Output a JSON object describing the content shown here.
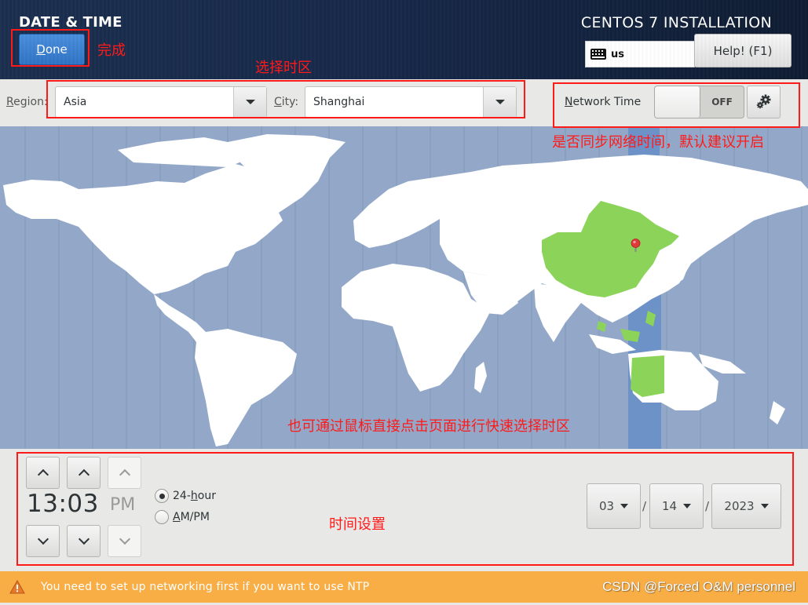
{
  "header": {
    "spoke_title": "DATE & TIME",
    "done_label_mnemonic": "D",
    "done_label_rest": "one",
    "product_title": "CENTOS 7 INSTALLATION",
    "keyboard_layout": "us",
    "help_label": "Help! (F1)"
  },
  "toolbar": {
    "region_label_mnemonic": "R",
    "region_label_rest": "egion:",
    "region_value": "Asia",
    "city_label_mnemonic": "C",
    "city_label_rest": "ity:",
    "city_value": "Shanghai",
    "network_time_label_mnemonic": "N",
    "network_time_label_rest": "etwork Time",
    "network_time_state": "OFF",
    "network_time_enabled": false
  },
  "map": {
    "selected_timezone": "Asia/Shanghai",
    "highlight_color": "#8cd35a",
    "ocean_color": "#93a8c8",
    "selected_zone_band_color": "#6d92c8",
    "pin_color": "#e03b3b"
  },
  "time": {
    "hours": "13",
    "separator": ":",
    "minutes": "03",
    "ampm": "PM",
    "format_24h_pre": "24-",
    "format_24h_mnemonic": "h",
    "format_24h_post": "our",
    "format_ampm_mnemonic": "A",
    "format_ampm_rest": "M/PM",
    "selected_format": "24-hour"
  },
  "date": {
    "month": "03",
    "day": "14",
    "year": "2023",
    "separator": "/"
  },
  "warning": {
    "message": "You need to set up networking first if you want to use NTP"
  },
  "watermark": "CSDN @Forced O&M personnel",
  "annotations": {
    "done": "完成",
    "select_timezone": "选择时区",
    "network_time": "是否同步网络时间，默认建议开启",
    "map_click": "也可通过鼠标直接点击页面进行快速选择时区",
    "time_settings": "时间设置"
  }
}
